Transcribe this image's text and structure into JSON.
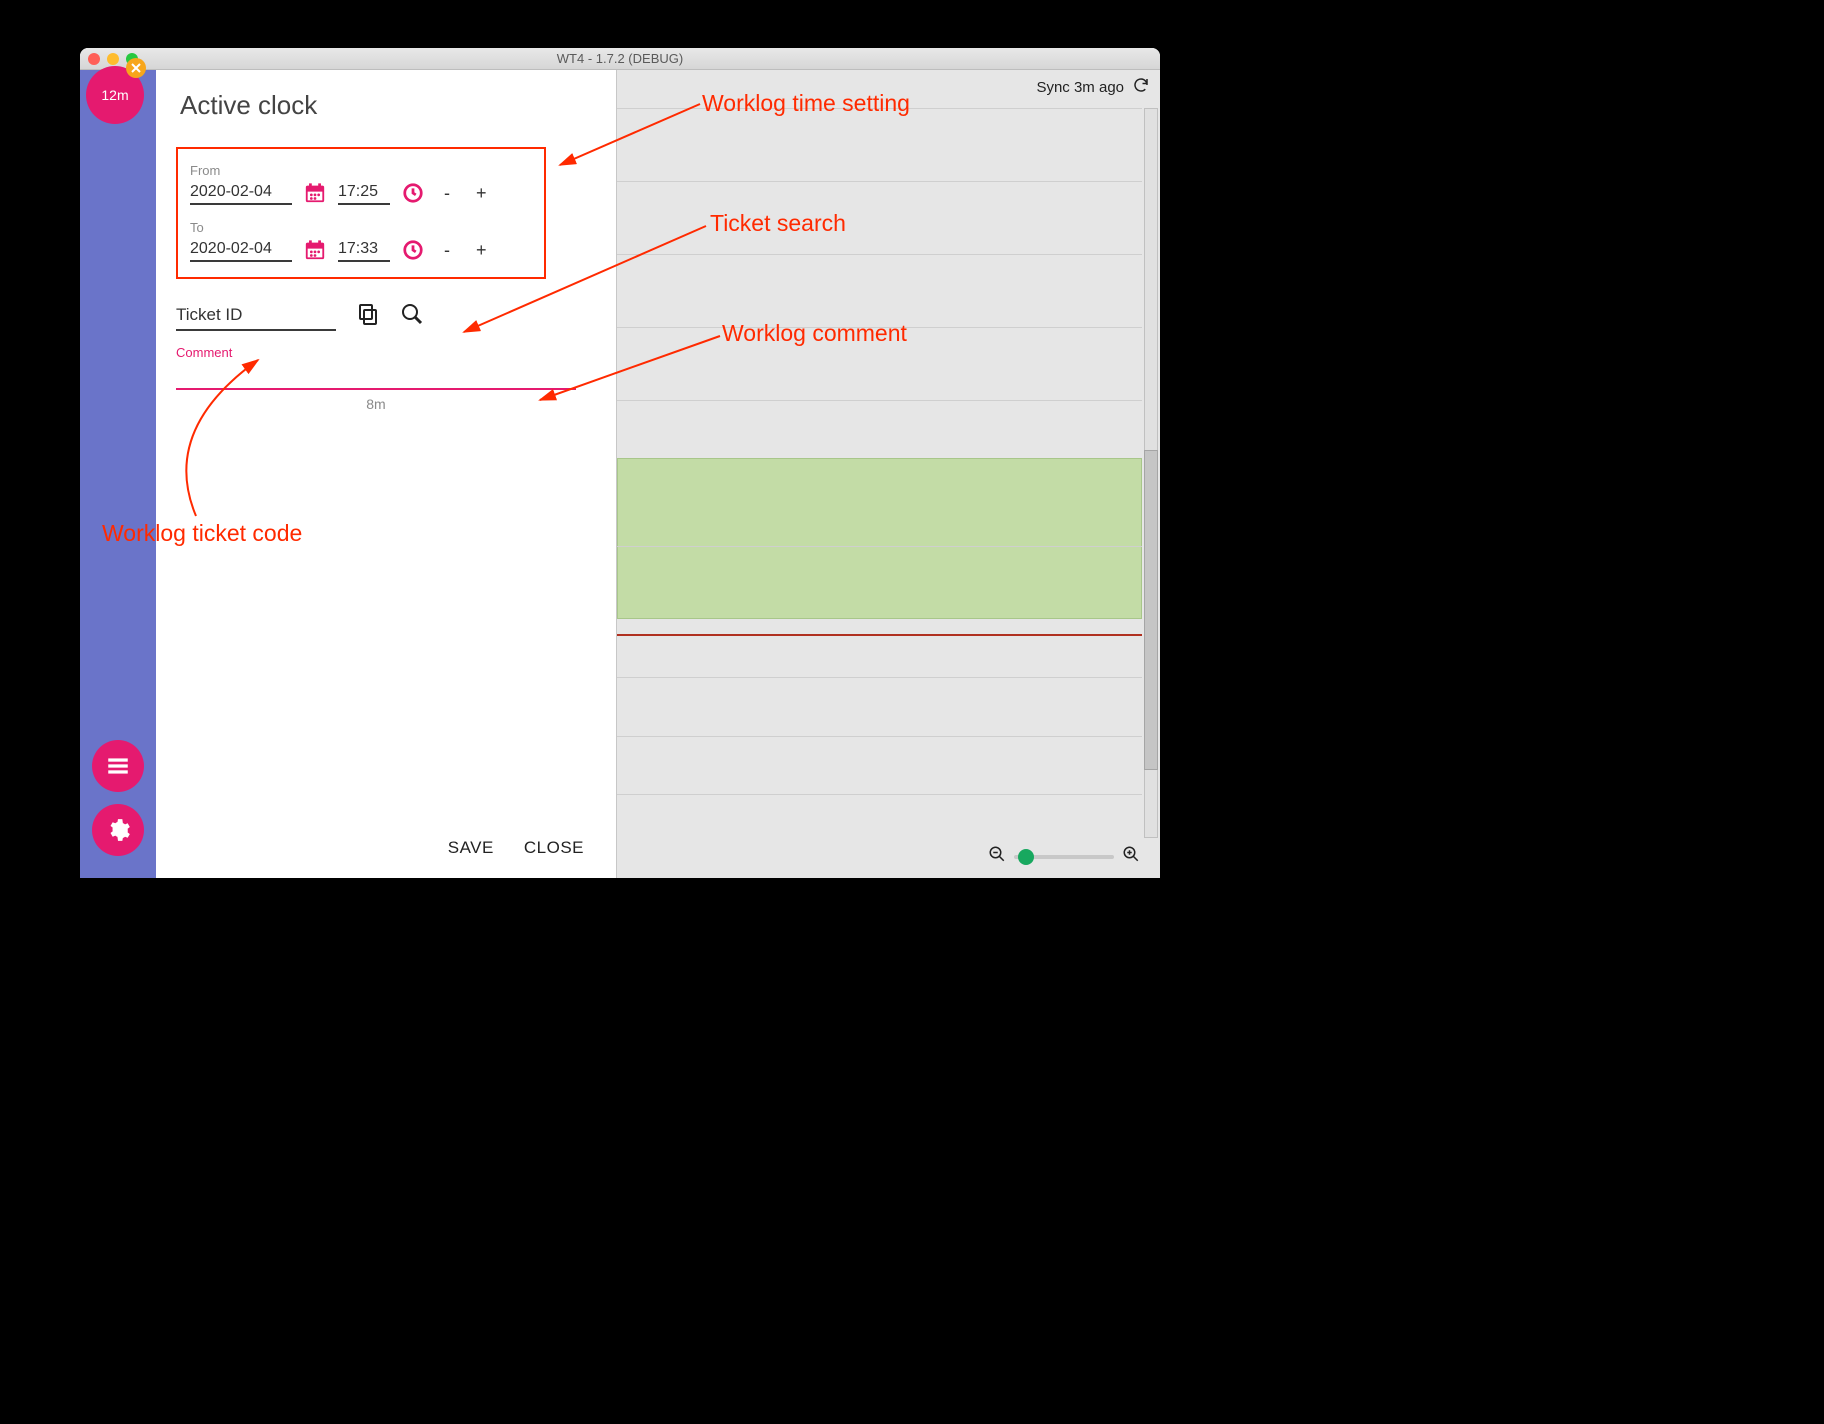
{
  "window": {
    "title": "WT4 - 1.7.2 (DEBUG)"
  },
  "sidebar": {
    "timer": "12m"
  },
  "panel": {
    "title": "Active clock",
    "from_label": "From",
    "from_date": "2020-02-04",
    "from_time": "17:25",
    "to_label": "To",
    "to_date": "2020-02-04",
    "to_time": "17:33",
    "minus": "-",
    "plus": "+",
    "ticket_placeholder": "Ticket ID",
    "comment_label": "Comment",
    "duration": "8m",
    "save": "SAVE",
    "close": "CLOSE"
  },
  "calendar": {
    "sync": "Sync 3m ago"
  },
  "annotations": {
    "time": "Worklog time setting",
    "search": "Ticket search",
    "comment": "Worklog comment",
    "ticket": "Worklog ticket code"
  }
}
